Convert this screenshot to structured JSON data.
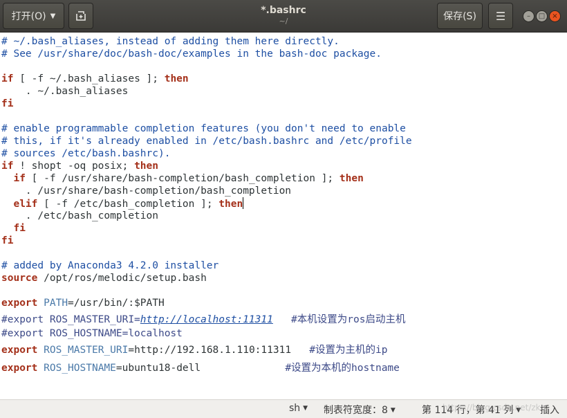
{
  "header": {
    "open_label": "打开(O)",
    "save_label": "保存(S)",
    "title": "*.bashrc",
    "subtitle": "~/",
    "menu_icon": "hamburger-icon",
    "new_icon": "new-document-icon"
  },
  "colors": {
    "comment": "#1e4fa3",
    "keyword": "#a4301a",
    "variable": "#4a79a8",
    "headerbar": "#3b3a37",
    "close_button": "#e95420"
  },
  "editor": {
    "l1": "# ~/.bash_aliases, instead of adding them here directly.",
    "l2": "# See /usr/share/doc/bash-doc/examples in the bash-doc package.",
    "if": "if",
    "then": "then",
    "fi": "fi",
    "elif": "elif",
    "l4_mid": " [ -f ~/.bash_aliases ]; ",
    "l5": "    . ~/.bash_aliases",
    "l8": "# enable programmable completion features (you don't need to enable",
    "l9": "# this, if it's already enabled in /etc/bash.bashrc and /etc/profile",
    "l10": "# sources /etc/bash.bashrc).",
    "l11_rest": " ! shopt -oq posix; ",
    "l12_mid": " [ -f /usr/share/bash-completion/bash_completion ]; ",
    "l13": "    . /usr/share/bash-completion/bash_completion",
    "l14_mid": " [ -f /etc/bash_completion ]; ",
    "l15": "    . /etc/bash_completion",
    "l19": "# added by Anaconda3 4.2.0 installer",
    "source": "source",
    "l20_rest": " /opt/ros/melodic/setup.bash",
    "export": "export",
    "path_var": "PATH",
    "l22_rest": "=/usr/bin/:$PATH",
    "l23_pre": "#export ROS_MASTER_URI=",
    "l23_link": "http://localhost:11311",
    "l23_comment": "   #本机设置为ros启动主机",
    "l24": "#export ROS_HOSTNAME=localhost",
    "ros_master_var": "ROS_MASTER_URI",
    "l25_val": "=http://192.168.1.110:11311",
    "l25_comment": "   #设置为主机的ip",
    "ros_host_var": "ROS_HOSTNAME",
    "l26_val": "=ubuntu18-dell",
    "l26_comment": "              #设置为本机的hostname"
  },
  "status": {
    "language": "sh",
    "tab_width": "制表符宽度：8",
    "position": "第 114 行，第 41 列",
    "insert_mode": "插入"
  },
  "watermark": "https://blog.csdn.net/zkq"
}
